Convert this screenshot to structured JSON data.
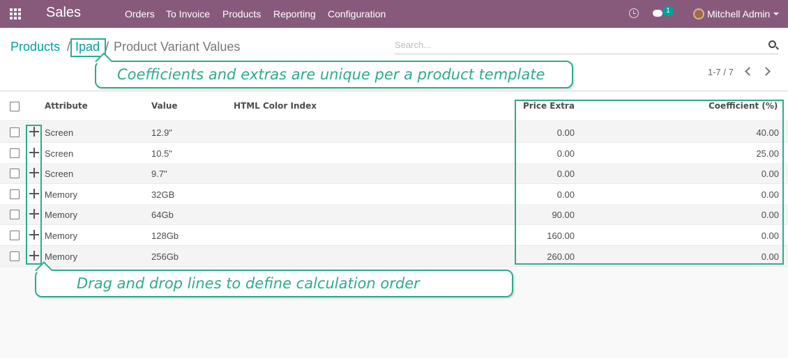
{
  "navbar": {
    "app_name": "Sales",
    "menu": [
      "Orders",
      "To Invoice",
      "Products",
      "Reporting",
      "Configuration"
    ],
    "chat_count": "1",
    "user": "Mitchell Admin"
  },
  "breadcrumb": {
    "root": "Products",
    "product": "Ipad",
    "current": "Product Variant Values",
    "separator": "/"
  },
  "search": {
    "placeholder": "Search..."
  },
  "pager": {
    "label": "1-7 / 7"
  },
  "table": {
    "headers": {
      "attribute": "Attribute",
      "value": "Value",
      "color": "HTML Color Index",
      "price_extra": "Price Extra",
      "coefficient": "Coefficient (%)"
    },
    "rows": [
      {
        "attribute": "Screen",
        "value": "12.9\"",
        "price_extra": "0.00",
        "coefficient": "40.00"
      },
      {
        "attribute": "Screen",
        "value": "10.5\"",
        "price_extra": "0.00",
        "coefficient": "25.00"
      },
      {
        "attribute": "Screen",
        "value": "9.7\"",
        "price_extra": "0.00",
        "coefficient": "0.00"
      },
      {
        "attribute": "Memory",
        "value": "32GB",
        "price_extra": "0.00",
        "coefficient": "0.00"
      },
      {
        "attribute": "Memory",
        "value": "64Gb",
        "price_extra": "90.00",
        "coefficient": "0.00"
      },
      {
        "attribute": "Memory",
        "value": "128Gb",
        "price_extra": "160.00",
        "coefficient": "0.00"
      },
      {
        "attribute": "Memory",
        "value": "256Gb",
        "price_extra": "260.00",
        "coefficient": "0.00"
      }
    ]
  },
  "annotations": {
    "top": "Coefficients and extras are unique per a product template",
    "bottom": "Drag and drop lines to define calculation order"
  },
  "colors": {
    "navbar": "#875a7b",
    "accent": "#00a09d",
    "annotation": "#2daa8f"
  }
}
